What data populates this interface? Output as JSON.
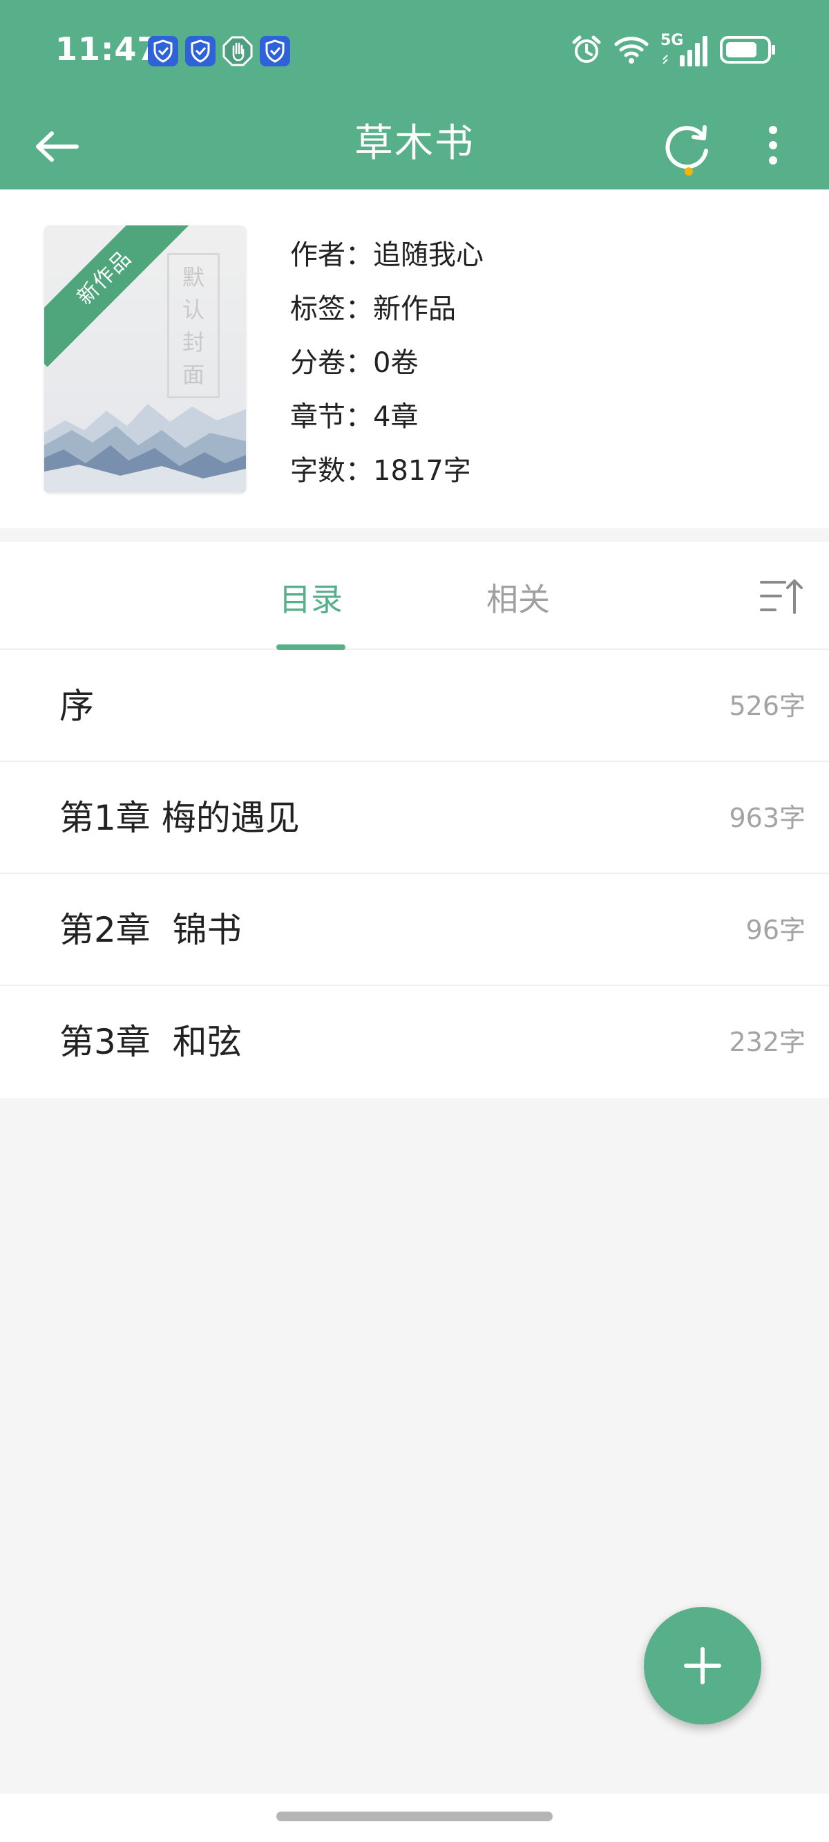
{
  "status_bar": {
    "time": "11:47",
    "network": "5G",
    "notification_icons": [
      "shield-check-icon",
      "shield-check-icon",
      "hand-stop-icon",
      "shield-check-icon"
    ]
  },
  "app_bar": {
    "title": "草木书",
    "sync_has_badge": true
  },
  "book": {
    "cover": {
      "ribbon": "新作品",
      "title_chars": [
        "默",
        "认",
        "封",
        "面"
      ]
    },
    "info": [
      "作者：追随我心",
      "标签：新作品",
      "分卷：0卷",
      "章节：4章",
      "字数：1817字"
    ]
  },
  "tabs": [
    {
      "label": "目录",
      "active": true
    },
    {
      "label": "相关",
      "active": false
    }
  ],
  "chapters": [
    {
      "title": "序",
      "words": "526字"
    },
    {
      "title": "第1章 梅的遇见",
      "words": "963字"
    },
    {
      "title": "第2章  锦书",
      "words": "96字"
    },
    {
      "title": "第3章  和弦",
      "words": "232字"
    }
  ],
  "colors": {
    "primary": "#58b08b",
    "ribbon": "#4fa57c",
    "badge": "#f5b400",
    "background": "#f5f5f5"
  }
}
